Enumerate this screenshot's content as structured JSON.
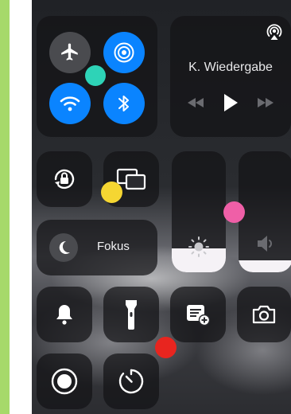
{
  "connectivity": {
    "airplane": {
      "icon": "airplane-icon",
      "state": "off"
    },
    "airdrop": {
      "icon": "airdrop-icon",
      "state": "on"
    },
    "wifi": {
      "icon": "wifi-icon",
      "state": "on"
    },
    "bluetooth": {
      "icon": "bluetooth-icon",
      "state": "on"
    }
  },
  "media": {
    "title": "K. Wiedergabe",
    "icons": [
      "airplay-icon",
      "rewind-icon",
      "play-icon",
      "fast-forward-icon"
    ]
  },
  "focus": {
    "label": "Fokus",
    "icon": "moon-icon"
  },
  "sliders": {
    "brightness": {
      "icon": "sun-icon",
      "level": 0.2
    },
    "volume": {
      "icon": "speaker-icon",
      "level": 0.1
    }
  },
  "tiles": [
    "rotation-lock-icon",
    "screen-mirroring-icon",
    "bell-icon",
    "flashlight-icon",
    "note-add-icon",
    "camera-icon",
    "screen-record-icon",
    "timer-icon"
  ],
  "colors": {
    "accent": "#0a84ff",
    "tile_bg": "#141416",
    "marker_teal": "#2ed3b7",
    "marker_yellow": "#f5d632",
    "marker_pink": "#ef5fa7",
    "marker_red": "#e8251f"
  }
}
